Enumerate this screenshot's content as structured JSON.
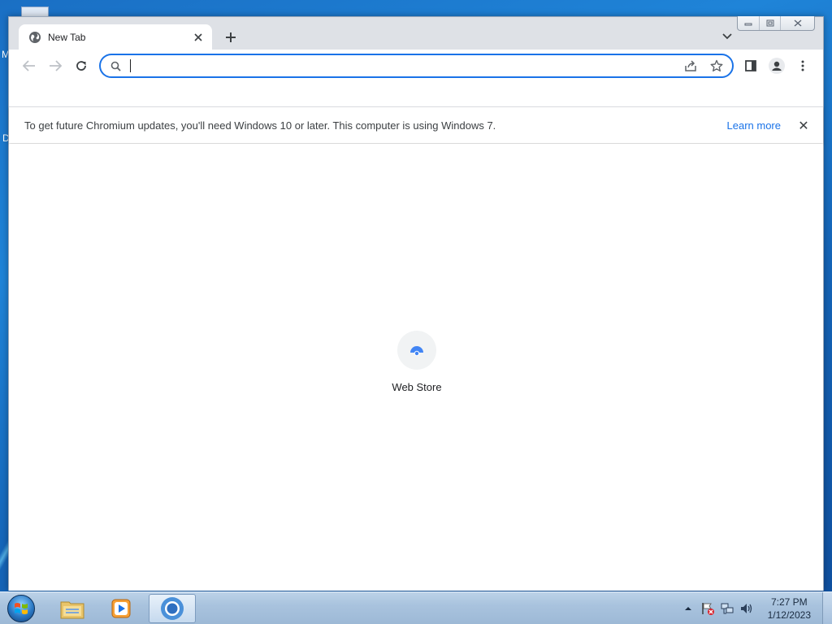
{
  "desktop": {
    "left_letters": [
      "M",
      "D"
    ]
  },
  "browser": {
    "tab": {
      "title": "New Tab",
      "favicon": "globe-icon",
      "close": "close-icon"
    },
    "new_tab_symbol": "+",
    "window_controls": [
      "minimize-icon",
      "restore-icon",
      "close-icon"
    ],
    "toolbar": {
      "back": "arrow-left-icon",
      "forward": "arrow-right-icon",
      "reload": "reload-icon",
      "omnibox": {
        "value": "",
        "search_icon": "search-icon",
        "share_icon": "share-icon",
        "bookmark_icon": "star-icon"
      },
      "side_panel": "side-panel-icon",
      "profile": "profile-icon",
      "menu": "kebab-menu-icon"
    },
    "infobar": {
      "message": "To get future Chromium updates, you'll need Windows 10 or later. This computer is using Windows 7.",
      "link": "Learn more",
      "close_symbol": "✕"
    },
    "shortcuts": [
      {
        "label": "Web Store",
        "icon": "web-store-icon"
      }
    ]
  },
  "taskbar": {
    "items": [
      "start-orb-icon",
      "file-explorer-icon",
      "media-player-icon",
      "chromium-icon"
    ],
    "tray_icons": [
      "show-hidden-icons",
      "action-center-flag-icon",
      "network-icon",
      "volume-icon"
    ],
    "time": "7:27 PM",
    "date": "1/12/2023"
  },
  "colors": {
    "accent": "#1a73e8",
    "tab_strip": "#dee1e6",
    "taskbar": "#a9c3de"
  }
}
